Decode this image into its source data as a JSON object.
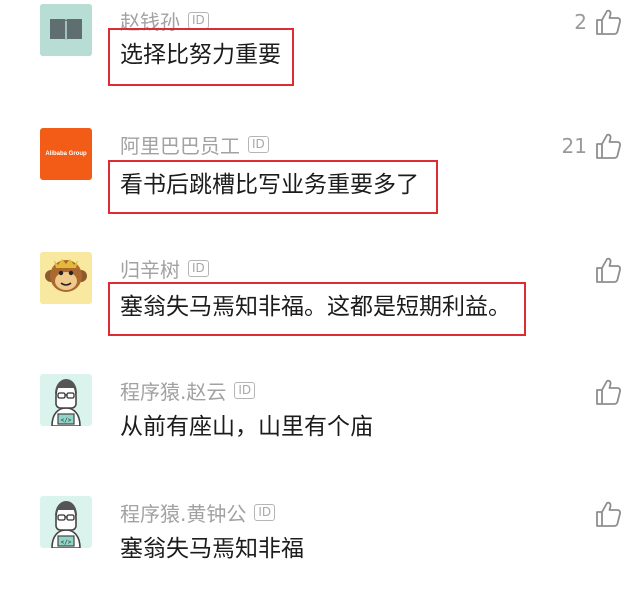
{
  "comments": [
    {
      "user": "赵钱孙",
      "id_badge": "ID",
      "text": "选择比努力重要",
      "likes": "2",
      "avatar": "book-icon",
      "highlighted": true
    },
    {
      "user": "阿里巴巴员工",
      "id_badge": "ID",
      "text": "看书后跳槽比写业务重要多了",
      "likes": "21",
      "avatar": "alibaba-logo",
      "avatar_logo_text": "Alibaba Group",
      "highlighted": true
    },
    {
      "user": "归辛树",
      "id_badge": "ID",
      "text": "塞翁失马焉知非福。这都是短期利益。",
      "likes": "",
      "avatar": "monkey-face-icon",
      "highlighted": true
    },
    {
      "user": "程序猿.赵云",
      "id_badge": "ID",
      "text": "从前有座山，山里有个庙",
      "likes": "",
      "avatar": "programmer-icon",
      "highlighted": false
    },
    {
      "user": "程序猿.黄钟公",
      "id_badge": "ID",
      "text": "塞翁失马焉知非福",
      "likes": "",
      "avatar": "programmer-icon",
      "highlighted": false
    }
  ],
  "colors": {
    "highlight_border": "#de2a32",
    "username": "#a2a2a2",
    "comment_text": "#1c1c1c",
    "alibaba_orange": "#f25c16"
  }
}
